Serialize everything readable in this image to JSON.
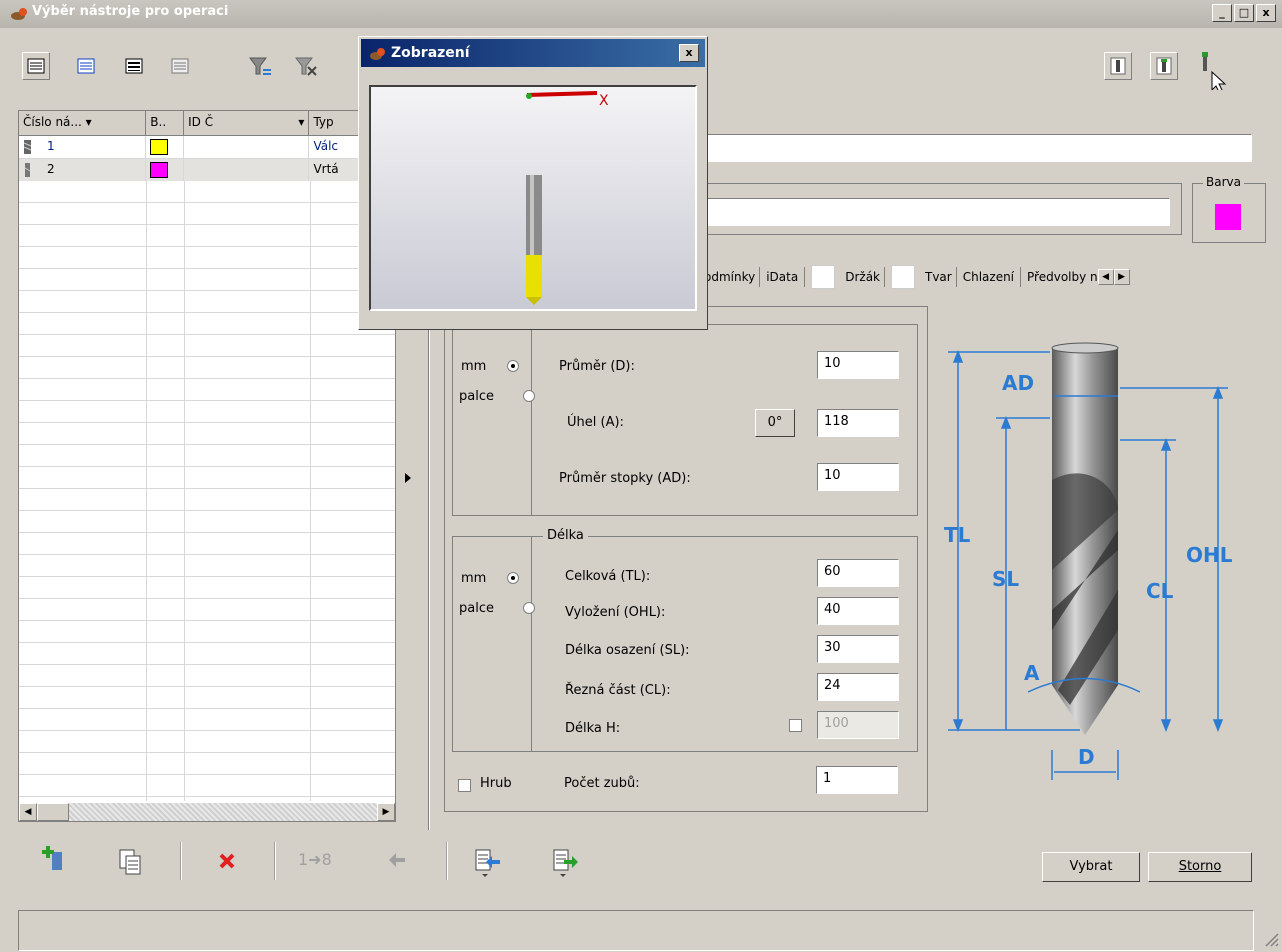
{
  "window": {
    "title": "Výběr nástroje pro operaci",
    "controls": [
      "_",
      "□",
      "x"
    ]
  },
  "popup": {
    "title": "Zobrazení",
    "close": "x",
    "axis_label": "X"
  },
  "grid": {
    "columns": [
      "Číslo ná...",
      "B..",
      "ID Č",
      "Typ"
    ],
    "rows": [
      {
        "number": "1",
        "color": "#ffff00",
        "id": "",
        "type": "Válc"
      },
      {
        "number": "2",
        "color": "#ff00ff",
        "id": "",
        "type": "Vrtá"
      }
    ]
  },
  "color_group": {
    "label": "Barva",
    "value": "#ff00ff"
  },
  "tabs": [
    "odmínky",
    "iData",
    "Držák",
    "Tvar",
    "Chlazení",
    "Předvolby n"
  ],
  "diameter_group": {
    "unit_mm": "mm",
    "unit_inch": "palce",
    "fields": [
      {
        "label": "Průměr (D):",
        "value": "10"
      },
      {
        "label": "Úhel (A):",
        "value": "118"
      },
      {
        "label": "Průměr stopky (AD):",
        "value": "10"
      }
    ],
    "angle_button": "0°"
  },
  "length_group": {
    "title": "Délka",
    "unit_mm": "mm",
    "unit_inch": "palce",
    "fields": [
      {
        "label": "Celková (TL):",
        "value": "60"
      },
      {
        "label": "Vyložení (OHL):",
        "value": "40"
      },
      {
        "label": "Délka osazení (SL):",
        "value": "30"
      },
      {
        "label": "Řezná část (CL):",
        "value": "24"
      },
      {
        "label": "Délka H:",
        "value": "100"
      }
    ]
  },
  "teeth": {
    "checkbox_label": "Hrub",
    "label": "Počet zubů:",
    "value": "1"
  },
  "diagram_labels": {
    "AD": "AD",
    "TL": "TL",
    "SL": "SL",
    "CL": "CL",
    "OHL": "OHL",
    "A": "A",
    "D": "D"
  },
  "bottom_toolbar": {
    "counter": "1➜8"
  },
  "buttons": {
    "select": "Vybrat",
    "cancel": "Storno"
  }
}
